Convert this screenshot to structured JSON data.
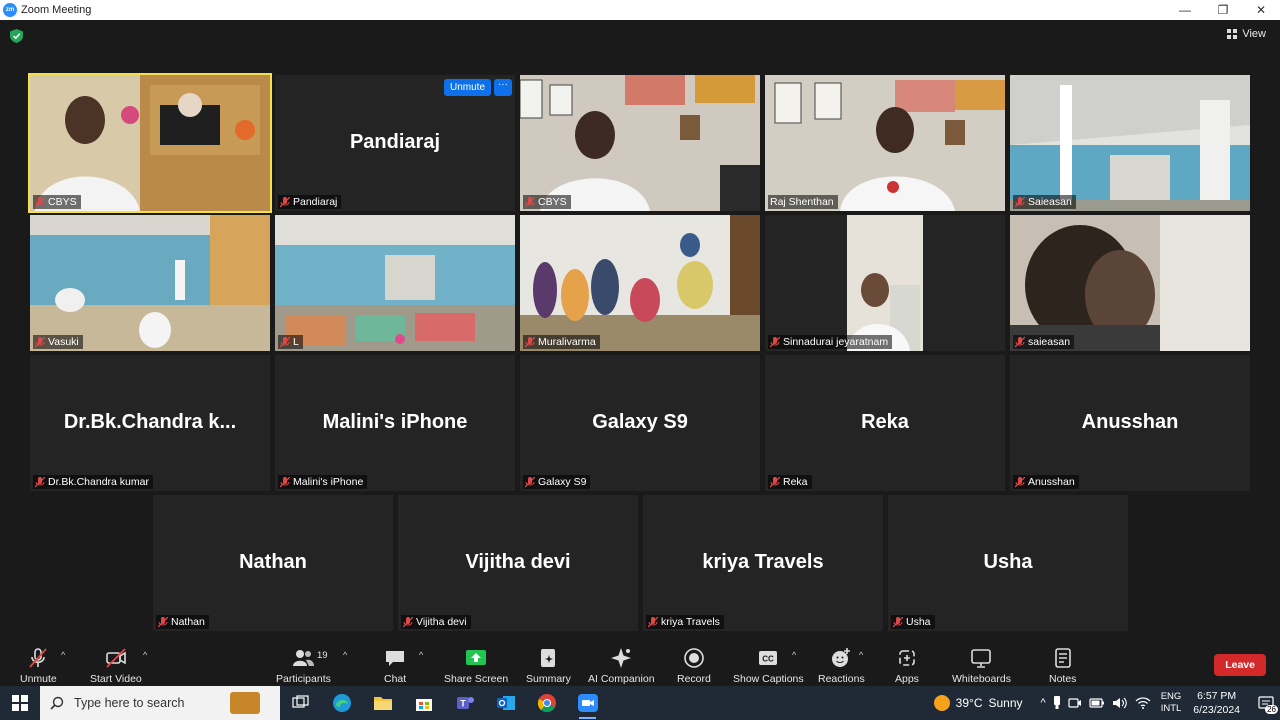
{
  "window": {
    "title": "Zoom Meeting",
    "app_icon_text": "zm",
    "minimize": "—",
    "maximize": "❐",
    "close": "✕"
  },
  "meeting": {
    "view_label": "View",
    "unmute_pill": "Unmute",
    "more_pill": "···",
    "tiles": [
      {
        "name": "CBYS",
        "big": "",
        "video": true,
        "active": true
      },
      {
        "name": "Pandiaraj",
        "big": "Pandiaraj",
        "video": false
      },
      {
        "name": "CBYS",
        "big": "",
        "video": true
      },
      {
        "name": "Raj Shenthan",
        "big": "",
        "video": true
      },
      {
        "name": "Saieasan",
        "big": "",
        "video": true
      },
      {
        "name": "Vasuki",
        "big": "",
        "video": true
      },
      {
        "name": "L",
        "big": "",
        "video": true
      },
      {
        "name": "Muralivarma",
        "big": "",
        "video": true
      },
      {
        "name": "Sinnadurai jeyaratnam",
        "big": "",
        "video": true
      },
      {
        "name": "saieasan",
        "big": "",
        "video": true
      },
      {
        "name": "Dr.Bk.Chandra kumar",
        "big": "Dr.Bk.Chandra  k...",
        "video": false
      },
      {
        "name": "Malini's iPhone",
        "big": "Malini's iPhone",
        "video": false
      },
      {
        "name": "Galaxy S9",
        "big": "Galaxy S9",
        "video": false
      },
      {
        "name": "Reka",
        "big": "Reka",
        "video": false
      },
      {
        "name": "Anusshan",
        "big": "Anusshan",
        "video": false
      },
      {
        "name": "Nathan",
        "big": "Nathan",
        "video": false
      },
      {
        "name": "Vijitha devi",
        "big": "Vijitha devi",
        "video": false
      },
      {
        "name": "kriya Travels",
        "big": "kriya Travels",
        "video": false
      },
      {
        "name": "Usha",
        "big": "Usha",
        "video": false
      }
    ]
  },
  "toolbar": {
    "unmute": "Unmute",
    "start_video": "Start Video",
    "participants": "Participants",
    "participant_count": "19",
    "chat": "Chat",
    "share_screen": "Share Screen",
    "summary": "Summary",
    "ai_companion": "AI Companion",
    "record": "Record",
    "show_captions": "Show Captions",
    "reactions": "Reactions",
    "apps": "Apps",
    "whiteboards": "Whiteboards",
    "notes": "Notes",
    "leave": "Leave",
    "caret": "^",
    "cc_badge": "CC"
  },
  "taskbar": {
    "search_placeholder": "Type here to search",
    "weather_temp": "39°C",
    "weather_text": "Sunny",
    "lang_top": "ENG",
    "lang_bottom": "INTL",
    "time": "6:57 PM",
    "date": "6/23/2024",
    "notification_count": "26",
    "tray_caret": "^"
  }
}
